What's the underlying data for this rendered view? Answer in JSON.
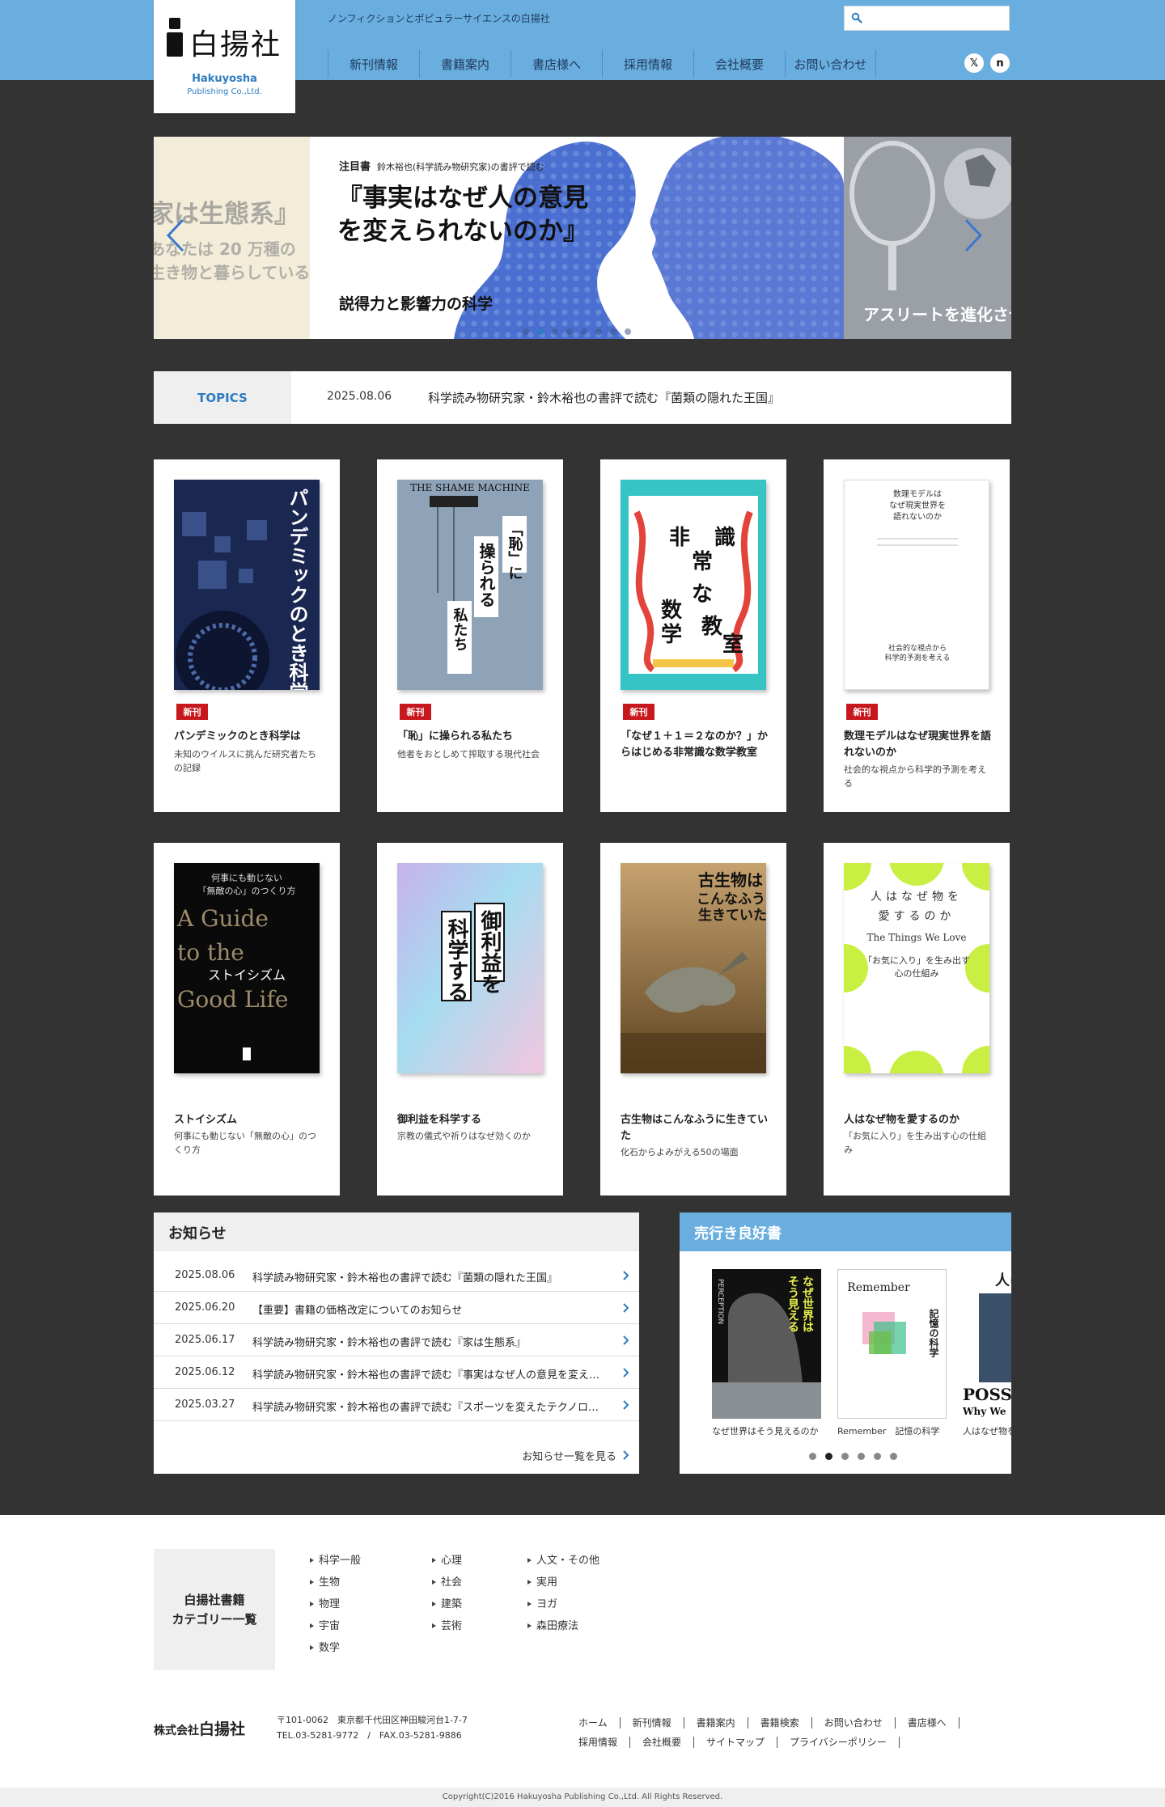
{
  "header": {
    "logo_kanji": "白揚社",
    "logo_en": "Hakuyosha",
    "logo_en_sub": "Publishing Co.,Ltd.",
    "tagline": "ノンフィクションとポピュラーサイエンスの白揚社",
    "search_placeholder": "",
    "nav": [
      "新刊情報",
      "書籍案内",
      "書店様へ",
      "採用情報",
      "会社概要",
      "お問い合わせ"
    ],
    "social": [
      {
        "name": "x-icon",
        "glyph": "𝕏"
      },
      {
        "name": "note-icon",
        "glyph": "n"
      }
    ]
  },
  "hero": {
    "left_ghost": [
      "家は生態系』",
      "あなたは 20 万種の",
      "生き物と暮らしている"
    ],
    "badge": "注目書",
    "badge_sub": "鈴木裕也(科学読み物研究家)の書評で読む",
    "title": "『事実はなぜ人の意見を変えられないのか』",
    "subtitle": "説得力と影響力の科学",
    "right_ghost": "アスリートを進化させ",
    "slide_count": 8,
    "active_slide": 1
  },
  "topics": {
    "label": "TOPICS",
    "date": "2025.08.06",
    "text": "科学読み物研究家・鈴木裕也の書評で読む『菌類の隠れた王国』"
  },
  "books": [
    {
      "badge": "新刊",
      "title": "パンデミックのとき科学は",
      "desc": "未知のウイルスに挑んだ研究者たちの記録",
      "cover_title": "パンデミックのとき科学は",
      "cover_bg": "#1b2a52"
    },
    {
      "badge": "新刊",
      "title": "「恥」に操られる私たち",
      "desc": "他者をおとしめて搾取する現代社会",
      "cover_title": "THE SHAME MACHINE",
      "cover_bg": "#8fa3b8"
    },
    {
      "badge": "新刊",
      "title": "「なぜ１＋１＝２なのか？」からはじめる非常識な数学教室",
      "desc": "",
      "cover_title": "非常識な数学教室",
      "cover_bg": "#37c4c4"
    },
    {
      "badge": "新刊",
      "title": "数理モデルはなぜ現実世界を語れないのか",
      "desc": "社会的な視点から科学的予測を考える",
      "cover_title": "数理モデルはなぜ現実世界を語れないのか",
      "cover_bg": "#ffffff"
    },
    {
      "badge": "",
      "title": "ストイシズム",
      "desc": "何事にも動じない「無敵の心」のつくり方",
      "cover_title": "A Guide to the Good Life",
      "cover_bg": "#0a0a0a"
    },
    {
      "badge": "",
      "title": "御利益を科学する",
      "desc": "宗教の儀式や祈りはなぜ効くのか",
      "cover_title": "御利益を科学する",
      "cover_bg": "#a8d8ee"
    },
    {
      "badge": "",
      "title": "古生物はこんなふうに生きていた",
      "desc": "化石からよみがえる50の場面",
      "cover_title": "古生物はこんなふうに生きていた",
      "cover_bg": "#6b5230"
    },
    {
      "badge": "",
      "title": "人はなぜ物を愛するのか",
      "desc": "「お気に入り」を生み出す心の仕組み",
      "cover_title": "人はなぜ物を愛するのか",
      "cover_bg": "#ffffff"
    }
  ],
  "news": {
    "heading": "お知らせ",
    "items": [
      {
        "date": "2025.08.06",
        "title": "科学読み物研究家・鈴木裕也の書評で読む『菌類の隠れた王国』"
      },
      {
        "date": "2025.06.20",
        "title": "【重要】書籍の価格改定についてのお知らせ"
      },
      {
        "date": "2025.06.17",
        "title": "科学読み物研究家・鈴木裕也の書評で読む『家は生態系』"
      },
      {
        "date": "2025.06.12",
        "title": "科学読み物研究家・鈴木裕也の書評で読む『事実はなぜ人の意見を変えられないのか』"
      },
      {
        "date": "2025.03.27",
        "title": "科学読み物研究家・鈴木裕也の書評で読む『スポーツを変えたテクノロジー』"
      }
    ],
    "more": "お知らせ一覧を見る"
  },
  "bestsellers": {
    "heading": "売行き良好書",
    "items": [
      {
        "caption": "なぜ世界はそう見えるのか",
        "cover_title": "PERCEPTION"
      },
      {
        "caption": "Remember　記憶の科学",
        "cover_title": "Remember"
      },
      {
        "caption": "人はなぜ物を",
        "cover_title": "POSS"
      }
    ],
    "dot_count": 6,
    "active_dot": 1
  },
  "footer": {
    "category_heading": "白揚社書籍\nカテゴリー一覧",
    "categories": [
      [
        "科学一般",
        "生物",
        "物理",
        "宇宙",
        "数学"
      ],
      [
        "心理",
        "社会",
        "建築",
        "芸術"
      ],
      [
        "人文・その他",
        "実用",
        "ヨガ",
        "森田療法"
      ]
    ],
    "company_prefix": "株式会社",
    "company_name": "白揚社",
    "address": "〒101-0062　東京都千代田区神田駿河台1-7-7",
    "tel": "TEL.03-5281-9772　/　FAX.03-5281-9886",
    "links_row1": [
      "ホーム",
      "新刊情報",
      "書籍案内",
      "書籍検索",
      "お問い合わせ",
      "書店様へ"
    ],
    "links_row2": [
      "採用情報",
      "会社概要",
      "サイトマップ",
      "プライバシーポリシー"
    ],
    "copyright": "Copyright(C)2016 Hakuyosha Publishing Co.,Ltd. All Rights Reserved."
  },
  "colors": {
    "header_blue": "#6aaee0",
    "accent_blue": "#2f7cc0",
    "new_red": "#c7181d",
    "page_dark": "#333333"
  }
}
